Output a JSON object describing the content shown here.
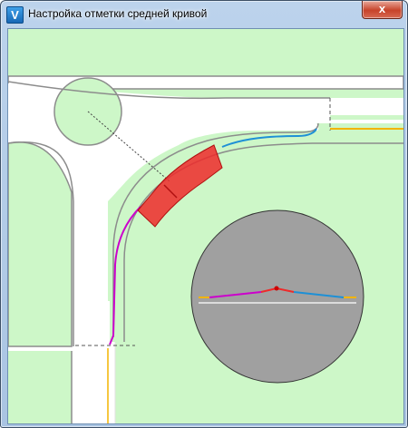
{
  "window": {
    "title": "Настройка отметки средней кривой",
    "app_icon_glyph": "V",
    "close_glyph": "x"
  },
  "icons": {
    "app": "civil3d-app-icon",
    "close": "close-icon"
  },
  "colors": {
    "background": "#cdf7c8",
    "road": "#ffffff",
    "edge": "#8c8c8c",
    "selected_region": "#ee2a2a",
    "left_curve": "#cc00cc",
    "right_curve": "#1e90d6",
    "line_yellow": "#f2b400",
    "profile_disc": "#a0a0a0"
  }
}
